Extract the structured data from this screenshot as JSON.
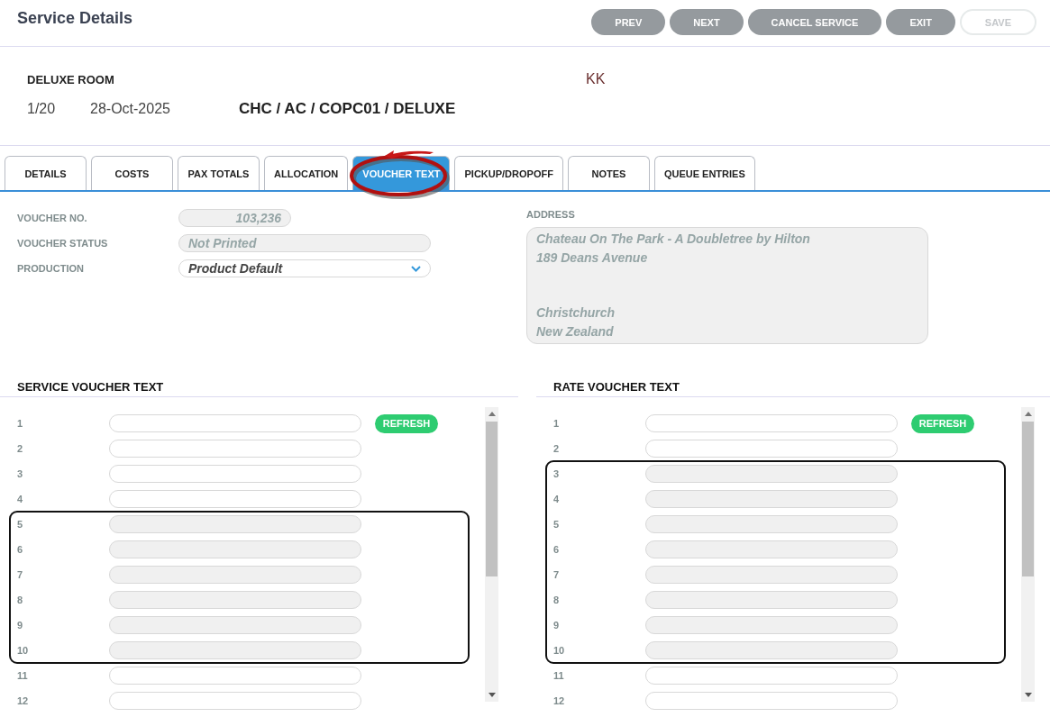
{
  "header": {
    "title": "Service Details",
    "buttons": [
      {
        "label": "PREV",
        "disabled": false
      },
      {
        "label": "NEXT",
        "disabled": false
      },
      {
        "label": "CANCEL SERVICE",
        "disabled": false
      },
      {
        "label": "EXIT",
        "disabled": false
      },
      {
        "label": "SAVE",
        "disabled": true
      }
    ]
  },
  "service": {
    "name": "DELUXE ROOM",
    "initials": "KK",
    "sequence": "1/20",
    "date": "28-Oct-2025",
    "code": "CHC / AC / COPC01 / DELUXE"
  },
  "tabs": [
    {
      "label": "DETAILS",
      "selected": false,
      "circled": false
    },
    {
      "label": "COSTS",
      "selected": false,
      "circled": false
    },
    {
      "label": "PAX TOTALS",
      "selected": false,
      "circled": false
    },
    {
      "label": "ALLOCATION",
      "selected": false,
      "circled": false
    },
    {
      "label": "VOUCHER TEXT",
      "selected": true,
      "circled": true
    },
    {
      "label": "PICKUP/DROPOFF",
      "selected": false,
      "circled": false
    },
    {
      "label": "NOTES",
      "selected": false,
      "circled": false
    },
    {
      "label": "QUEUE ENTRIES",
      "selected": false,
      "circled": false
    }
  ],
  "form": {
    "fields": [
      {
        "label": "VOUCHER NO.",
        "value": "103,236",
        "kind": "number"
      },
      {
        "label": "VOUCHER STATUS",
        "value": "Not Printed",
        "kind": "text"
      },
      {
        "label": "PRODUCTION",
        "value": "Product Default",
        "kind": "select"
      }
    ],
    "address": {
      "label": "ADDRESS",
      "street_lines": [
        "Chateau On The Park - A Doubletree by Hilton",
        "189 Deans Avenue"
      ],
      "locality_lines": [
        "Christchurch",
        "New Zealand"
      ]
    }
  },
  "panels": [
    {
      "title": "SERVICE VOUCHER TEXT",
      "refresh": "REFRESH",
      "row_groups": [
        {
          "highlighted": false,
          "rows": [
            {
              "number": "1",
              "disabled": false
            },
            {
              "number": "2",
              "disabled": false
            },
            {
              "number": "3",
              "disabled": false
            },
            {
              "number": "4",
              "disabled": false
            }
          ]
        },
        {
          "highlighted": true,
          "rows": [
            {
              "number": "5",
              "disabled": true
            },
            {
              "number": "6",
              "disabled": true
            },
            {
              "number": "7",
              "disabled": true
            },
            {
              "number": "8",
              "disabled": true
            },
            {
              "number": "9",
              "disabled": true
            },
            {
              "number": "10",
              "disabled": true
            }
          ]
        },
        {
          "highlighted": false,
          "rows": [
            {
              "number": "11",
              "disabled": false
            },
            {
              "number": "12",
              "disabled": false
            }
          ]
        }
      ]
    },
    {
      "title": "RATE VOUCHER TEXT",
      "refresh": "REFRESH",
      "row_groups": [
        {
          "highlighted": false,
          "rows": [
            {
              "number": "1",
              "disabled": false
            },
            {
              "number": "2",
              "disabled": false
            }
          ]
        },
        {
          "highlighted": true,
          "rows": [
            {
              "number": "3",
              "disabled": true
            },
            {
              "number": "4",
              "disabled": true
            },
            {
              "number": "5",
              "disabled": true
            },
            {
              "number": "6",
              "disabled": true
            },
            {
              "number": "7",
              "disabled": true
            },
            {
              "number": "8",
              "disabled": true
            },
            {
              "number": "9",
              "disabled": true
            },
            {
              "number": "10",
              "disabled": true
            }
          ]
        },
        {
          "highlighted": false,
          "rows": [
            {
              "number": "11",
              "disabled": false
            },
            {
              "number": "12",
              "disabled": false
            }
          ]
        }
      ]
    }
  ]
}
